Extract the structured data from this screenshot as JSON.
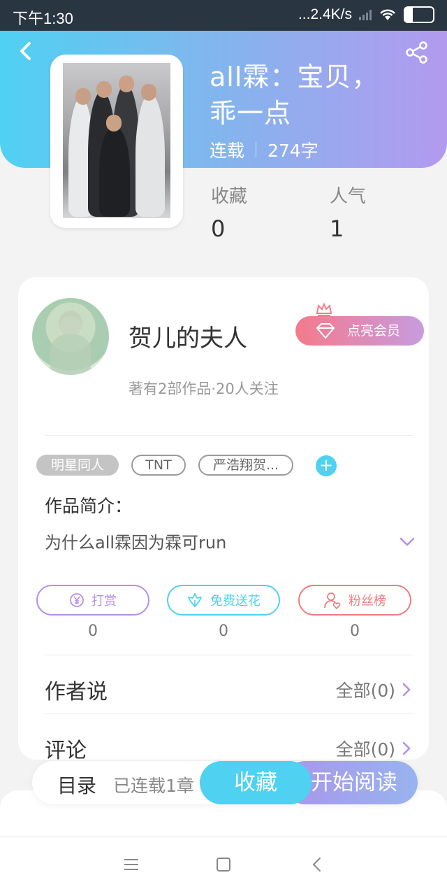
{
  "status_bar": {
    "time": "下午1:30",
    "network_speed": "...2.4K/s",
    "battery": "27"
  },
  "book": {
    "title_line1": "all霖：宝贝，",
    "title_line2": "乖一点",
    "status": "连载",
    "word_count": "274字",
    "stats": [
      {
        "label": "收藏",
        "value": "0"
      },
      {
        "label": "人气",
        "value": "1"
      }
    ]
  },
  "author": {
    "name": "贺儿的夫人",
    "subtitle": "著有2部作品·20人关注",
    "vip_label": "点亮会员"
  },
  "tags": [
    "明星同人",
    "TNT",
    "严浩翔贺..."
  ],
  "intro": {
    "heading": "作品简介：",
    "text": "为什么all霖因为霖可run"
  },
  "actions": [
    {
      "label": "打赏",
      "count": "0",
      "icon": "yen-coin-icon",
      "color": "#b68ee6"
    },
    {
      "label": "免费送花",
      "count": "0",
      "icon": "flower-icon",
      "color": "#4fd1f2"
    },
    {
      "label": "粉丝榜",
      "count": "0",
      "icon": "fan-user-heart-icon",
      "color": "#f07b7b"
    }
  ],
  "rows": [
    {
      "title": "作者说",
      "link": "全部(0)"
    },
    {
      "title": "评论",
      "link": "全部(0)"
    }
  ],
  "bottom_bar": {
    "toc_label": "目录",
    "chapters_label": "已连载1章",
    "collect_label": "收藏",
    "read_label": "开始阅读"
  },
  "colors": {
    "accent_cyan": "#4fd1f2",
    "accent_purple": "#b39aef",
    "vip_pink": "#f57a8a"
  }
}
